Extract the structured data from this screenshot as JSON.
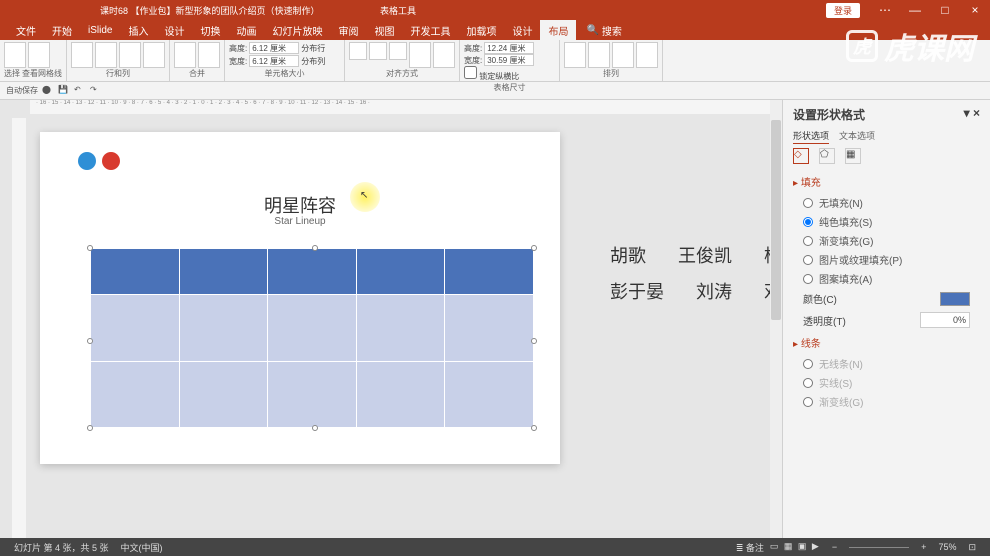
{
  "titlebar": {
    "doc_title": "课时68 【作业包】新型形象的团队介绍页（快速制作）",
    "tool_title": "表格工具",
    "login": "登录",
    "min": "—",
    "max": "□",
    "close": "×",
    "opt": "⋯"
  },
  "menu": {
    "items": [
      "文件",
      "开始",
      "iSlide",
      "插入",
      "设计",
      "切换",
      "动画",
      "幻灯片放映",
      "审阅",
      "视图",
      "开发工具",
      "加载项",
      "设计",
      "布局"
    ],
    "active_index": 13,
    "search_icon": "🔍",
    "search": "搜索"
  },
  "ribbon": {
    "groups": {
      "select": "选择",
      "gridlines": "查看网格线",
      "rows_cols": "行和列",
      "insert_above": "在上方插入",
      "insert_below": "在下方插入",
      "insert_left": "在左侧插入",
      "insert_right": "在右侧插入",
      "merge": "合并",
      "merge_cells": "合并单元格",
      "split_cells": "拆分单元格",
      "cell_size": "单元格大小",
      "height": "高度:",
      "height_val": "6.12 厘米",
      "width": "宽度:",
      "width_val": "6.12 厘米",
      "dist_rows": "分布行",
      "dist_cols": "分布列",
      "alignment": "对齐方式",
      "text_dir": "文字方向",
      "cell_margins": "单元格边距",
      "table_size": "表格尺寸",
      "t_height": "高度:",
      "t_height_val": "12.24 厘米",
      "t_width": "宽度:",
      "t_width_val": "30.59 厘米",
      "lock_ratio": "锁定纵横比",
      "arrange": "排列",
      "bring_fwd": "上移一层",
      "send_back": "下移一层",
      "sel_pane": "选择窗格",
      "align": "对齐"
    }
  },
  "qat": {
    "autosave": "自动保存"
  },
  "hruler_text": "· 16 · 15 · 14 · 13 · 12 · 11 · 10 · 9 · 8 · 7 · 6 · 5 · 4 · 3 · 2 · 1 · 0 · 1 · 2 · 3 · 4 · 5 · 6 · 7 · 8 · 9 · 10 · 11 · 12 · 13 · 14 · 15 · 16 ·",
  "slide": {
    "title": "明星阵容",
    "subtitle": "Star Lineup",
    "names_row1": [
      "胡歌",
      "王俊凯",
      "杨"
    ],
    "names_row2": [
      "彭于晏",
      "刘涛",
      "邓"
    ]
  },
  "watermark": {
    "icon": "虎",
    "text": "虎课网"
  },
  "format_pane": {
    "title": "设置形状格式",
    "close": "×",
    "dropdown": "▾",
    "tab1": "形状选项",
    "tab2": "文本选项",
    "section_fill": "填充",
    "opts": {
      "no_fill": "无填充(N)",
      "solid": "纯色填充(S)",
      "gradient": "渐变填充(G)",
      "picture": "图片或纹理填充(P)",
      "pattern": "图案填充(A)"
    },
    "color_label": "颜色(C)",
    "transparency": "透明度(T)",
    "transparency_val": "0%",
    "section_line": "线条",
    "line_opts": {
      "no_line": "无线条(N)",
      "solid_line": "实线(S)",
      "gradient_line": "渐变线(G)"
    }
  },
  "statusbar": {
    "slide_info": "幻灯片 第 4 张，共 5 张",
    "lang": "中文(中国)",
    "notes": "备注",
    "zoom": "75%",
    "fit": "⊡",
    "plus": "+",
    "minus": "−"
  }
}
